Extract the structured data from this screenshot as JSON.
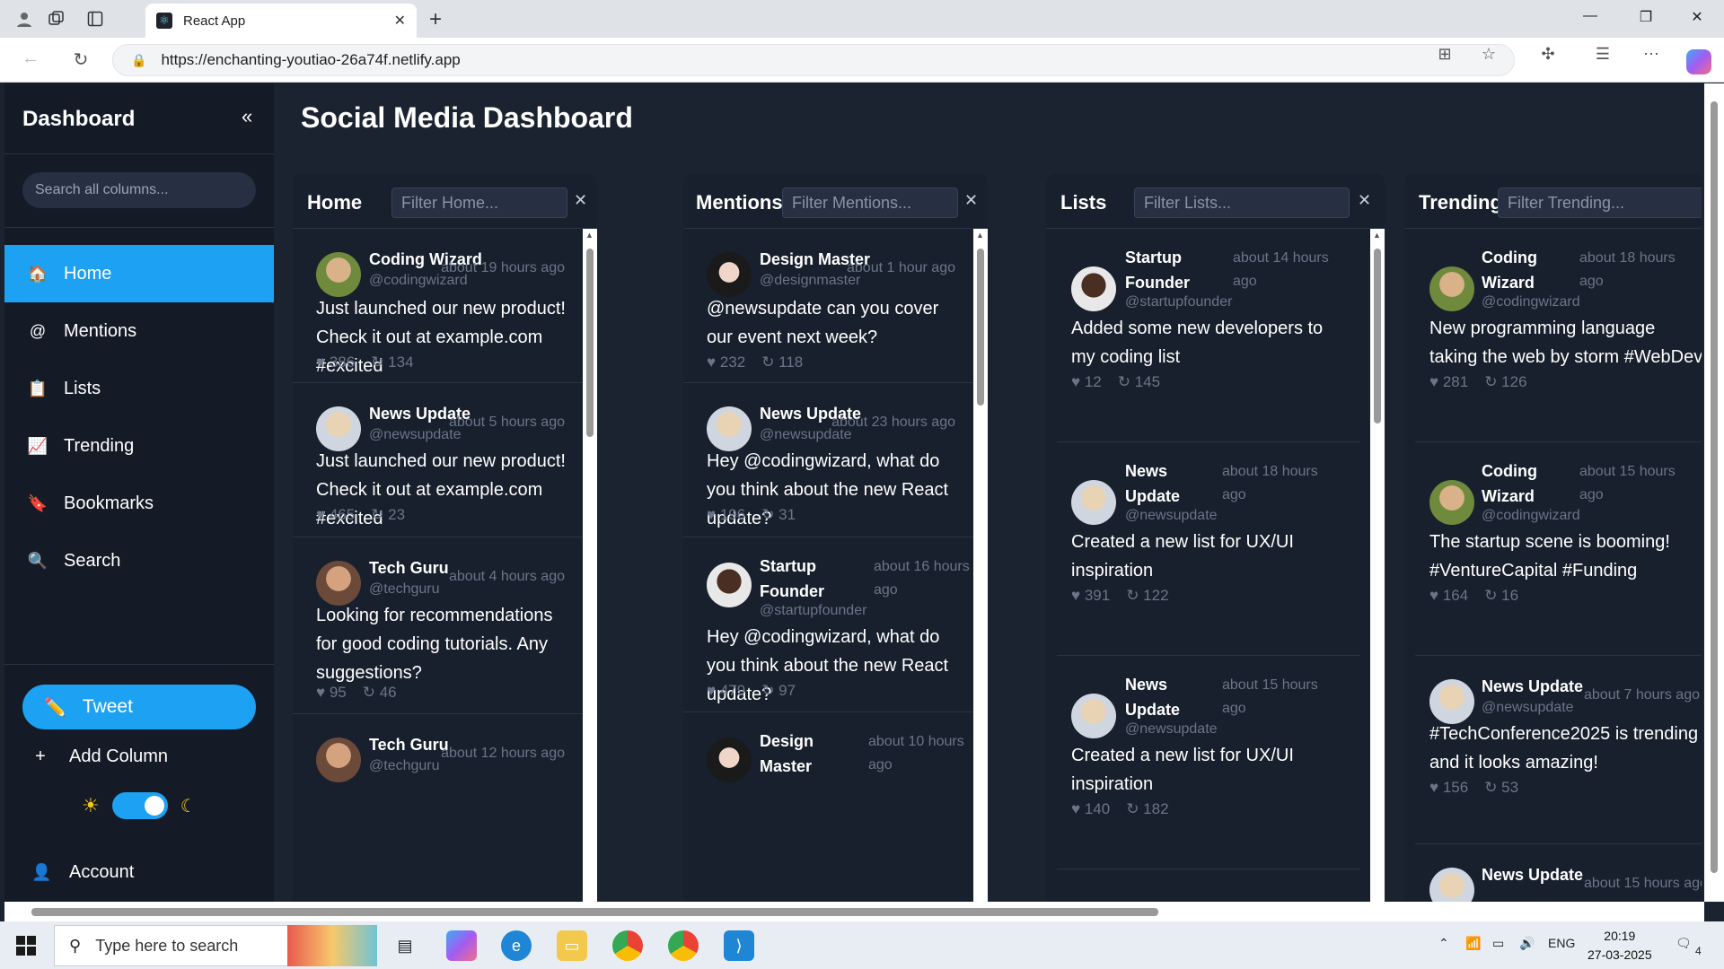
{
  "browser": {
    "tab_title": "React App",
    "url": "https://enchanting-youtiao-26a74f.netlify.app"
  },
  "sidebar": {
    "title": "Dashboard",
    "collapse_icon": "«",
    "search_placeholder": "Search all columns...",
    "items": [
      {
        "label": "Home",
        "icon": "🏠"
      },
      {
        "label": "Mentions",
        "icon": "@"
      },
      {
        "label": "Lists",
        "icon": "📋"
      },
      {
        "label": "Trending",
        "icon": "📈"
      },
      {
        "label": "Bookmarks",
        "icon": "🔖"
      },
      {
        "label": "Search",
        "icon": "🔍"
      }
    ],
    "tweet_label": "Tweet",
    "add_column_label": "Add Column",
    "account_label": "Account"
  },
  "main": {
    "title": "Social Media Dashboard"
  },
  "columns": [
    {
      "title": "Home",
      "filter_placeholder": "Filter Home...",
      "posts": [
        {
          "name": "Coding Wizard",
          "handle": "@codingwizard",
          "time": "about 19 hours ago",
          "content": "Just launched our new product! Check it out at example.com #excited",
          "likes": "♥ 386",
          "retweets": "↻ 134"
        },
        {
          "name": "News Update",
          "handle": "@newsupdate",
          "time": "about 5 hours ago",
          "content": "Just launched our new product! Check it out at example.com #excited",
          "likes": "♥ 465",
          "retweets": "↻ 23"
        },
        {
          "name": "Tech Guru",
          "handle": "@techguru",
          "time": "about 4 hours ago",
          "content": "Looking for recommendations for good coding tutorials. Any suggestions?",
          "likes": "♥ 95",
          "retweets": "↻ 46"
        },
        {
          "name": "Tech Guru",
          "handle": "@techguru",
          "time": "about 12 hours ago",
          "content": "",
          "likes": "",
          "retweets": ""
        }
      ]
    },
    {
      "title": "Mentions",
      "filter_placeholder": "Filter Mentions...",
      "posts": [
        {
          "name": "Design Master",
          "handle": "@designmaster",
          "time": "about 1 hour ago",
          "content": "@newsupdate can you cover our event next week?",
          "likes": "♥ 232",
          "retweets": "↻ 118"
        },
        {
          "name": "News Update",
          "handle": "@newsupdate",
          "time": "about 23 hours ago",
          "content": "Hey @codingwizard, what do you think about the new React update?",
          "likes": "♥ 196",
          "retweets": "↻ 31"
        },
        {
          "name": "Startup Founder",
          "handle": "@startupfounder",
          "time": "about 16 hours ago",
          "content": "Hey @codingwizard, what do you think about the new React update?",
          "likes": "♥ 479",
          "retweets": "↻ 97"
        },
        {
          "name": "Design Master",
          "handle": "",
          "time": "about 10 hours ago",
          "content": "",
          "likes": "",
          "retweets": ""
        }
      ]
    },
    {
      "title": "Lists",
      "filter_placeholder": "Filter Lists...",
      "posts": [
        {
          "name": "Startup Founder",
          "handle": "@startupfounder",
          "time": "about 14 hours ago",
          "content": "Added some new developers to my coding list",
          "likes": "♥ 12",
          "retweets": "↻ 145"
        },
        {
          "name": "News Update",
          "handle": "@newsupdate",
          "time": "about 18 hours ago",
          "content": "Created a new list for UX/UI inspiration",
          "likes": "♥ 391",
          "retweets": "↻ 122"
        },
        {
          "name": "News Update",
          "handle": "@newsupdate",
          "time": "about 15 hours ago",
          "content": "Created a new list for UX/UI inspiration",
          "likes": "♥ 140",
          "retweets": "↻ 182"
        }
      ]
    },
    {
      "title": "Trending",
      "filter_placeholder": "Filter Trending...",
      "posts": [
        {
          "name": "Coding Wizard",
          "handle": "@codingwizard",
          "time": "about 18 hours ago",
          "content": "New programming language taking the web by storm #WebDev",
          "likes": "♥ 281",
          "retweets": "↻ 126"
        },
        {
          "name": "Coding Wizard",
          "handle": "@codingwizard",
          "time": "about 15 hours ago",
          "content": "The startup scene is booming! #VentureCapital #Funding",
          "likes": "♥ 164",
          "retweets": "↻ 16"
        },
        {
          "name": "News Update",
          "handle": "@newsupdate",
          "time": "about 7 hours ago",
          "content": "#TechConference2025 is trending and it looks amazing!",
          "likes": "♥ 156",
          "retweets": "↻ 53"
        },
        {
          "name": "News Update",
          "handle": "",
          "time": "about 15 hours ago",
          "content": "",
          "likes": "",
          "retweets": ""
        }
      ]
    }
  ],
  "taskbar": {
    "search_placeholder": "Type here to search",
    "language": "ENG",
    "time": "20:19",
    "date": "27-03-2025",
    "notification_count": "4"
  },
  "colors": {
    "accent": "#1da1f2",
    "sidebar_bg": "#141b27",
    "main_bg": "#1c2330",
    "column_bg": "#18202d"
  }
}
